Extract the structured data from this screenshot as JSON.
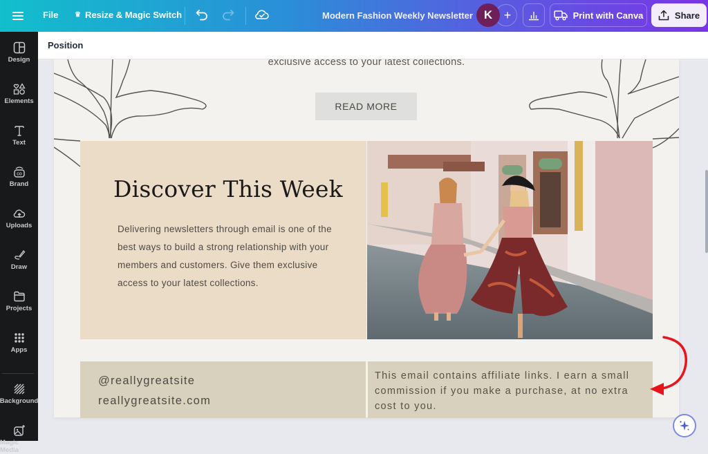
{
  "topbar": {
    "menu_icon": "hamburger-icon",
    "file_label": "File",
    "resize_label": "Resize & Magic Switch",
    "resize_icon": "crown-icon",
    "undo_icon": "undo-icon",
    "redo_icon": "redo-icon",
    "save_status_icon": "cloud-check-icon",
    "document_title": "Modern Fashion Weekly Newsletter",
    "avatar_initial": "K",
    "add_collaborator_icon": "plus-icon",
    "analytics_icon": "bar-chart-icon",
    "print_label": "Print with Canva",
    "print_icon": "truck-icon",
    "share_label": "Share",
    "share_icon": "upload-icon"
  },
  "sidebar": {
    "items": [
      {
        "label": "Design",
        "icon": "layout-icon"
      },
      {
        "label": "Elements",
        "icon": "shapes-icon"
      },
      {
        "label": "Text",
        "icon": "text-icon"
      },
      {
        "label": "Brand",
        "icon": "brand-icon"
      },
      {
        "label": "Uploads",
        "icon": "cloud-upload-icon"
      },
      {
        "label": "Draw",
        "icon": "pen-icon"
      },
      {
        "label": "Projects",
        "icon": "folder-icon"
      },
      {
        "label": "Apps",
        "icon": "grid-icon"
      },
      {
        "label": "Background",
        "icon": "hatch-icon"
      },
      {
        "label": "Magic Media",
        "icon": "image-sparkle-icon"
      }
    ]
  },
  "context_bar": {
    "position_label": "Position"
  },
  "newsletter": {
    "intro_tail": "exclusive access to your latest collections.",
    "read_more_label": "READ MORE",
    "discover_title": "Discover This Week",
    "discover_body": "Delivering newsletters through email is one of the best ways to build a strong relationship with your members and customers. Give them exclusive access to your latest collections.",
    "photo_alt": "Two women in boho maxi skirts walking hand in hand down a colorful street",
    "social_handle": "@reallygreatsite",
    "website": "reallygreatsite.com",
    "disclaimer": "This email contains affiliate links. I earn a small commission if you make a purchase, at no extra cost to you."
  },
  "annotation": {
    "arrow_color": "#e8141c"
  },
  "colors": {
    "discover_bg": "#ebdcc8",
    "footer_bg": "#d8d1bd",
    "page_bg": "#f4f2ee"
  },
  "magic_button_icon": "sparkle-icon"
}
